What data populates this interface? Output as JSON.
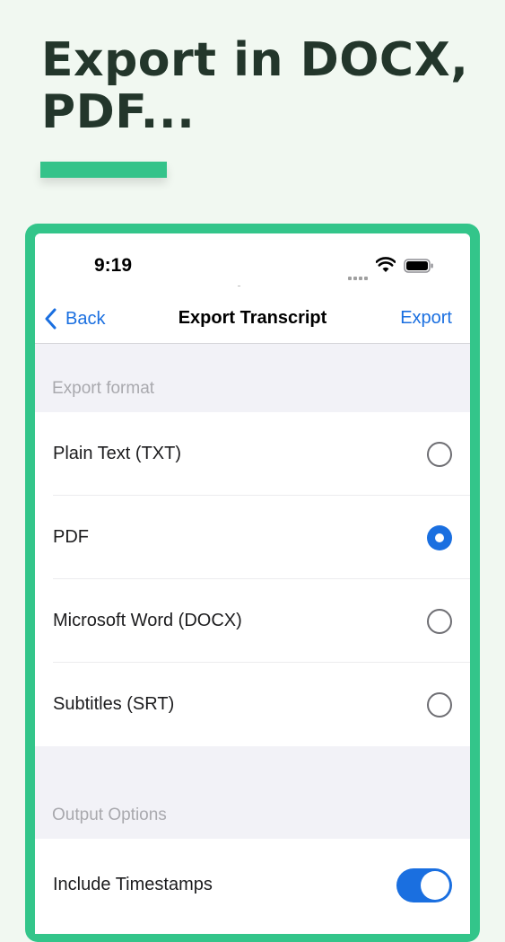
{
  "headline": {
    "line1": "Export in DOCX,",
    "line2": "PDF..."
  },
  "status_bar": {
    "time": "9:19"
  },
  "nav": {
    "back_label": "Back",
    "title": "Export Transcript",
    "action_label": "Export"
  },
  "export_format": {
    "header": "Export format",
    "options": [
      {
        "label": "Plain Text (TXT)",
        "selected": false
      },
      {
        "label": "PDF",
        "selected": true
      },
      {
        "label": "Microsoft Word (DOCX)",
        "selected": false
      },
      {
        "label": "Subtitles (SRT)",
        "selected": false
      }
    ]
  },
  "output_options": {
    "header": "Output Options",
    "items": [
      {
        "label": "Include Timestamps",
        "enabled": true
      }
    ]
  },
  "colors": {
    "accent_green": "#34c38a",
    "ios_blue": "#1a6fe0",
    "headline_text": "#23362b"
  }
}
